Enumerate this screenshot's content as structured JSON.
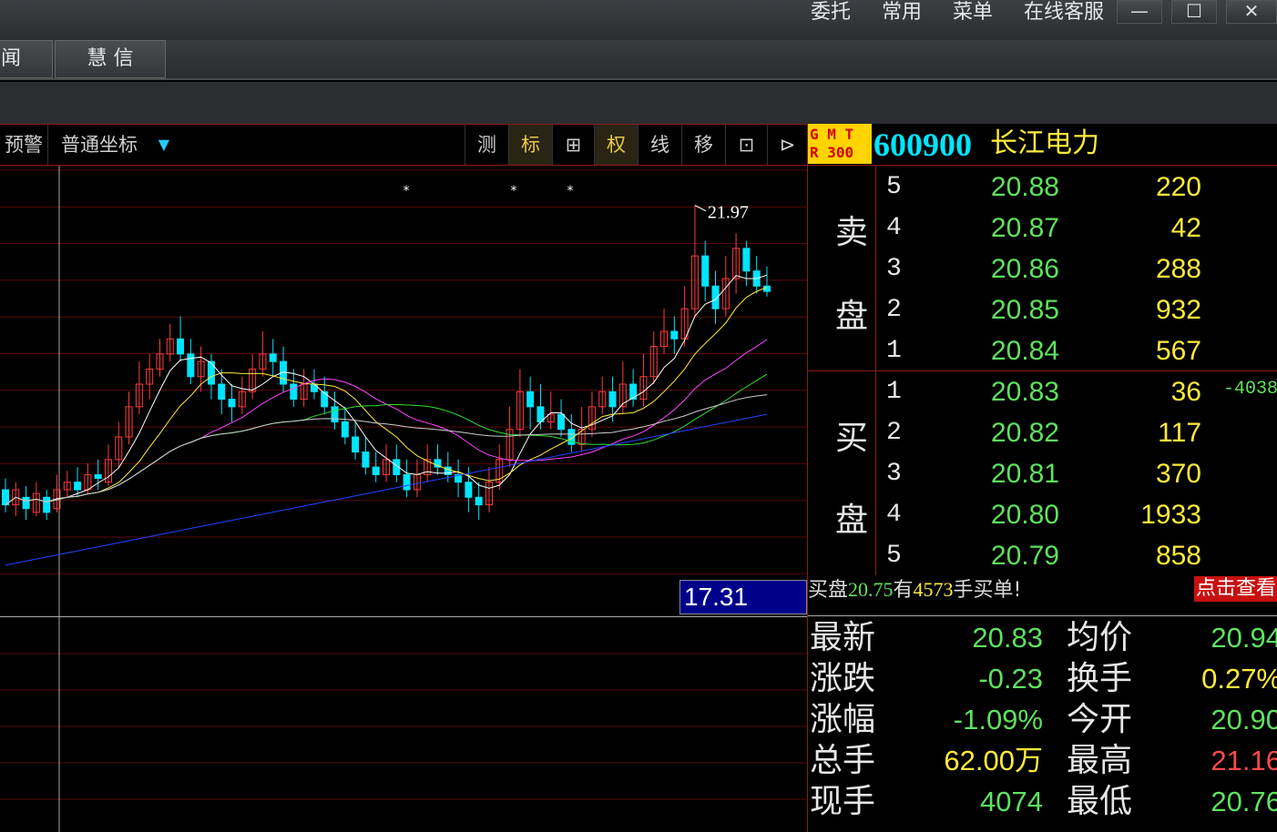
{
  "top_menu": [
    "委托",
    "常用",
    "菜单",
    "在线客服"
  ],
  "window_controls": {
    "minimize": "—",
    "maximize": "☐",
    "close": "✕"
  },
  "tabs": [
    {
      "label": "闻"
    },
    {
      "label": "⋮"
    },
    {
      "label": "慧 信"
    }
  ],
  "chart_toolbar": {
    "left": [
      "预警",
      "普通坐标"
    ],
    "dropdown_arrow": "▼",
    "tools": [
      {
        "label": "测",
        "active": false
      },
      {
        "label": "标",
        "active": true
      },
      {
        "label": "⊞",
        "active": false
      },
      {
        "label": "权",
        "active": true
      },
      {
        "label": "线",
        "active": false
      },
      {
        "label": "移",
        "active": false
      },
      {
        "label": "⊡",
        "active": false
      },
      {
        "label": "⊳",
        "active": false
      }
    ]
  },
  "chart_data": {
    "type": "candlestick",
    "high_annotation": "21.97",
    "cursor_price": "17.31",
    "price_range": [
      16.8,
      22.4
    ],
    "candles": [
      [
        18.2,
        18.0,
        18.35,
        17.9
      ],
      [
        18.0,
        18.2,
        18.3,
        17.85
      ],
      [
        18.1,
        17.95,
        18.25,
        17.8
      ],
      [
        17.9,
        18.15,
        18.3,
        17.85
      ],
      [
        18.1,
        17.9,
        18.2,
        17.8
      ],
      [
        17.95,
        18.2,
        18.4,
        17.9
      ],
      [
        18.2,
        18.3,
        18.45,
        18.1
      ],
      [
        18.3,
        18.2,
        18.5,
        18.1
      ],
      [
        18.2,
        18.4,
        18.55,
        18.15
      ],
      [
        18.4,
        18.35,
        18.6,
        18.2
      ],
      [
        18.3,
        18.6,
        18.8,
        18.25
      ],
      [
        18.6,
        18.9,
        19.1,
        18.5
      ],
      [
        18.9,
        19.3,
        19.5,
        18.8
      ],
      [
        19.3,
        19.6,
        19.9,
        19.2
      ],
      [
        19.6,
        19.8,
        20.0,
        19.4
      ],
      [
        19.8,
        20.0,
        20.2,
        19.7
      ],
      [
        20.0,
        20.2,
        20.4,
        19.9
      ],
      [
        20.2,
        20.0,
        20.5,
        19.9
      ],
      [
        20.0,
        19.7,
        20.2,
        19.6
      ],
      [
        19.7,
        19.9,
        20.1,
        19.5
      ],
      [
        19.9,
        19.6,
        20.0,
        19.4
      ],
      [
        19.6,
        19.4,
        19.8,
        19.2
      ],
      [
        19.4,
        19.3,
        19.6,
        19.1
      ],
      [
        19.3,
        19.5,
        19.7,
        19.2
      ],
      [
        19.5,
        19.8,
        20.0,
        19.4
      ],
      [
        19.8,
        20.0,
        20.3,
        19.7
      ],
      [
        20.0,
        19.9,
        20.2,
        19.7
      ],
      [
        19.9,
        19.6,
        20.1,
        19.5
      ],
      [
        19.6,
        19.4,
        19.8,
        19.3
      ],
      [
        19.4,
        19.6,
        19.8,
        19.3
      ],
      [
        19.6,
        19.5,
        19.8,
        19.4
      ],
      [
        19.5,
        19.3,
        19.7,
        19.2
      ],
      [
        19.3,
        19.1,
        19.5,
        19.0
      ],
      [
        19.1,
        18.9,
        19.3,
        18.8
      ],
      [
        18.9,
        18.7,
        19.1,
        18.6
      ],
      [
        18.7,
        18.5,
        18.9,
        18.4
      ],
      [
        18.5,
        18.4,
        18.7,
        18.3
      ],
      [
        18.4,
        18.6,
        18.8,
        18.3
      ],
      [
        18.6,
        18.4,
        18.8,
        18.3
      ],
      [
        18.4,
        18.2,
        18.6,
        18.1
      ],
      [
        18.2,
        18.4,
        18.6,
        18.1
      ],
      [
        18.4,
        18.6,
        18.8,
        18.3
      ],
      [
        18.6,
        18.5,
        18.8,
        18.4
      ],
      [
        18.5,
        18.4,
        18.7,
        18.3
      ],
      [
        18.4,
        18.3,
        18.6,
        18.1
      ],
      [
        18.3,
        18.1,
        18.5,
        17.9
      ],
      [
        18.1,
        18.0,
        18.3,
        17.8
      ],
      [
        18.0,
        18.3,
        18.5,
        17.9
      ],
      [
        18.3,
        18.6,
        18.8,
        18.2
      ],
      [
        18.6,
        19.0,
        19.3,
        18.5
      ],
      [
        19.0,
        19.5,
        19.8,
        18.9
      ],
      [
        19.5,
        19.3,
        19.7,
        19.0
      ],
      [
        19.3,
        19.1,
        19.6,
        19.0
      ],
      [
        19.1,
        19.2,
        19.5,
        19.0
      ],
      [
        19.2,
        19.0,
        19.4,
        18.9
      ],
      [
        19.0,
        18.8,
        19.2,
        18.7
      ],
      [
        18.8,
        19.0,
        19.3,
        18.7
      ],
      [
        19.0,
        19.3,
        19.5,
        18.9
      ],
      [
        19.3,
        19.5,
        19.7,
        19.2
      ],
      [
        19.5,
        19.3,
        19.7,
        19.1
      ],
      [
        19.3,
        19.6,
        19.9,
        19.2
      ],
      [
        19.6,
        19.4,
        19.8,
        19.3
      ],
      [
        19.4,
        19.7,
        20.0,
        19.3
      ],
      [
        19.7,
        20.1,
        20.3,
        19.6
      ],
      [
        20.1,
        20.3,
        20.6,
        20.0
      ],
      [
        20.3,
        20.2,
        20.5,
        20.0
      ],
      [
        20.2,
        20.6,
        20.9,
        20.1
      ],
      [
        20.6,
        21.3,
        21.97,
        20.5
      ],
      [
        21.3,
        20.9,
        21.5,
        20.7
      ],
      [
        20.9,
        20.6,
        21.1,
        20.4
      ],
      [
        20.6,
        21.0,
        21.3,
        20.5
      ],
      [
        21.0,
        21.4,
        21.6,
        20.8
      ],
      [
        21.4,
        21.1,
        21.5,
        20.9
      ],
      [
        21.1,
        20.9,
        21.3,
        20.8
      ],
      [
        20.9,
        20.83,
        21.16,
        20.76
      ]
    ]
  },
  "quote": {
    "badge": [
      "G M T",
      "R 300"
    ],
    "code": "600900",
    "name": "长江电力",
    "sell_label": [
      "卖",
      "盘"
    ],
    "buy_label": [
      "买",
      "盘"
    ],
    "sell": [
      {
        "level": "5",
        "price": "20.88",
        "volume": "220"
      },
      {
        "level": "4",
        "price": "20.87",
        "volume": "42"
      },
      {
        "level": "3",
        "price": "20.86",
        "volume": "288"
      },
      {
        "level": "2",
        "price": "20.85",
        "volume": "932"
      },
      {
        "level": "1",
        "price": "20.84",
        "volume": "567"
      }
    ],
    "buy": [
      {
        "level": "1",
        "price": "20.83",
        "volume": "36",
        "extra": "-4038"
      },
      {
        "level": "2",
        "price": "20.82",
        "volume": "117",
        "extra": ""
      },
      {
        "level": "3",
        "price": "20.81",
        "volume": "370",
        "extra": ""
      },
      {
        "level": "4",
        "price": "20.80",
        "volume": "1933",
        "extra": ""
      },
      {
        "level": "5",
        "price": "20.79",
        "volume": "858",
        "extra": ""
      }
    ],
    "notice": {
      "prefix": "买盘",
      "price": "20.75",
      "mid": "有",
      "count": "4573",
      "suffix": "手买单!",
      "button": "点击查看"
    },
    "stats": [
      {
        "k1": "最新",
        "v1": "20.83",
        "c1": "green",
        "k2": "均价",
        "v2": "20.94",
        "c2": "green"
      },
      {
        "k1": "涨跌",
        "v1": "-0.23",
        "c1": "green",
        "k2": "换手",
        "v2": "0.27%",
        "c2": "yellow"
      },
      {
        "k1": "涨幅",
        "v1": "-1.09%",
        "c1": "green",
        "k2": "今开",
        "v2": "20.90",
        "c2": "green"
      },
      {
        "k1": "总手",
        "v1": "62.00万",
        "c1": "yellow",
        "k2": "最高",
        "v2": "21.16",
        "c2": "red"
      },
      {
        "k1": "现手",
        "v1": "4074",
        "c1": "green",
        "k2": "最低",
        "v2": "20.76",
        "c2": "green"
      }
    ]
  },
  "colors": {
    "up": "#ff3b3b",
    "down": "#00e5ff",
    "grid": "#5a0a0a",
    "accent_border": "#8c1a1a"
  }
}
